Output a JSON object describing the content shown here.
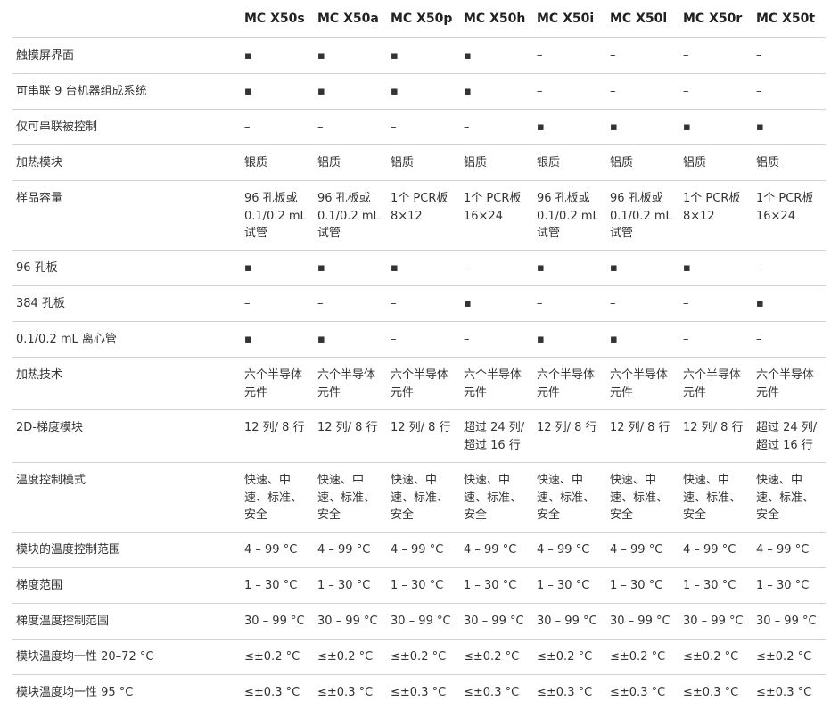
{
  "columns": [
    "",
    "MC X50s",
    "MC X50a",
    "MC X50p",
    "MC X50h",
    "MC X50i",
    "MC X50l",
    "MC X50r",
    "MC X50t"
  ],
  "rows": [
    {
      "size": "h40",
      "label": "触摸屏界面",
      "cells": [
        "▪",
        "▪",
        "▪",
        "▪",
        "–",
        "–",
        "–",
        "–"
      ]
    },
    {
      "size": "h40",
      "label": "可串联 9 台机器组成系统",
      "cells": [
        "▪",
        "▪",
        "▪",
        "▪",
        "–",
        "–",
        "–",
        "–"
      ]
    },
    {
      "size": "h40",
      "label": "仅可串联被控制",
      "cells": [
        "–",
        "–",
        "–",
        "–",
        "▪",
        "▪",
        "▪",
        "▪"
      ]
    },
    {
      "size": "h40",
      "label": "加热模块",
      "cells": [
        "银质",
        "铝质",
        "铝质",
        "铝质",
        "银质",
        "铝质",
        "铝质",
        "铝质"
      ]
    },
    {
      "size": "h78",
      "label": "样品容量",
      "cells": [
        "96 孔板或\n0.1/0.2 mL\n试管",
        "96 孔板或\n0.1/0.2 mL\n试管",
        "1个 PCR板\n8×12",
        "1个 PCR板\n16×24",
        "96 孔板或\n0.1/0.2 mL\n试管",
        "96 孔板或\n0.1/0.2 mL\n试管",
        "1个 PCR板\n8×12",
        "1个 PCR板\n16×24"
      ]
    },
    {
      "size": "h40",
      "label": "96 孔板",
      "cells": [
        "▪",
        "▪",
        "▪",
        "–",
        "▪",
        "▪",
        "▪",
        "–"
      ]
    },
    {
      "size": "h40",
      "label": "384 孔板",
      "cells": [
        "–",
        "–",
        "–",
        "▪",
        "–",
        "–",
        "–",
        "▪"
      ]
    },
    {
      "size": "h40",
      "label": "0.1/0.2 mL 离心管",
      "cells": [
        "▪",
        "▪",
        "–",
        "–",
        "▪",
        "▪",
        "–",
        "–"
      ]
    },
    {
      "size": "h59",
      "label": "加热技术",
      "cells": [
        "六个半导体\n元件",
        "六个半导体\n元件",
        "六个半导体\n元件",
        "六个半导体\n元件",
        "六个半导体\n元件",
        "六个半导体\n元件",
        "六个半导体\n元件",
        "六个半导体\n元件"
      ]
    },
    {
      "size": "h59",
      "label": "2D-梯度模块",
      "cells": [
        "12 列/ 8 行",
        "12 列/ 8 行",
        "12 列/ 8 行",
        "超过 24 列/\n超过 16 行",
        "12 列/ 8 行",
        "12 列/ 8 行",
        "12 列/ 8 行",
        "超过 24 列/\n超过 16 行"
      ]
    },
    {
      "size": "h78",
      "label": "温度控制模式",
      "cells": [
        "快速、中\n速、标准、\n安全",
        "快速、中\n速、标准、\n安全",
        "快速、中\n速、标准、\n安全",
        "快速、中\n速、标准、\n安全",
        "快速、中\n速、标准、\n安全",
        "快速、中\n速、标准、\n安全",
        "快速、中\n速、标准、\n安全",
        "快速、中\n速、标准、\n安全"
      ]
    },
    {
      "size": "h40",
      "label": "模块的温度控制范围",
      "cells": [
        "4 – 99 °C",
        "4 – 99 °C",
        "4 – 99 °C",
        "4 – 99 °C",
        "4 – 99 °C",
        "4 – 99 °C",
        "4 – 99 °C",
        "4 – 99 °C"
      ]
    },
    {
      "size": "h40",
      "label": "梯度范围",
      "cells": [
        "1 – 30 °C",
        "1 – 30 °C",
        "1 – 30 °C",
        "1 – 30 °C",
        "1 – 30 °C",
        "1 – 30 °C",
        "1 – 30 °C",
        "1 – 30 °C"
      ]
    },
    {
      "size": "h40",
      "label": "梯度温度控制范围",
      "cells": [
        "30 – 99 °C",
        "30 – 99 °C",
        "30 – 99 °C",
        "30 – 99 °C",
        "30 – 99 °C",
        "30 – 99 °C",
        "30 – 99 °C",
        "30 – 99 °C"
      ]
    },
    {
      "size": "h40",
      "label": "模块温度均一性 20–72 °C",
      "cells": [
        "≤±0.2 °C",
        "≤±0.2 °C",
        "≤±0.2 °C",
        "≤±0.2 °C",
        "≤±0.2 °C",
        "≤±0.2 °C",
        "≤±0.2 °C",
        "≤±0.2 °C"
      ]
    },
    {
      "size": "h40",
      "label": "模块温度均一性 95 °C",
      "cells": [
        "≤±0.3 °C",
        "≤±0.3 °C",
        "≤±0.3 °C",
        "≤±0.3 °C",
        "≤±0.3 °C",
        "≤±0.3 °C",
        "≤±0.3 °C",
        "≤±0.3 °C"
      ]
    }
  ]
}
